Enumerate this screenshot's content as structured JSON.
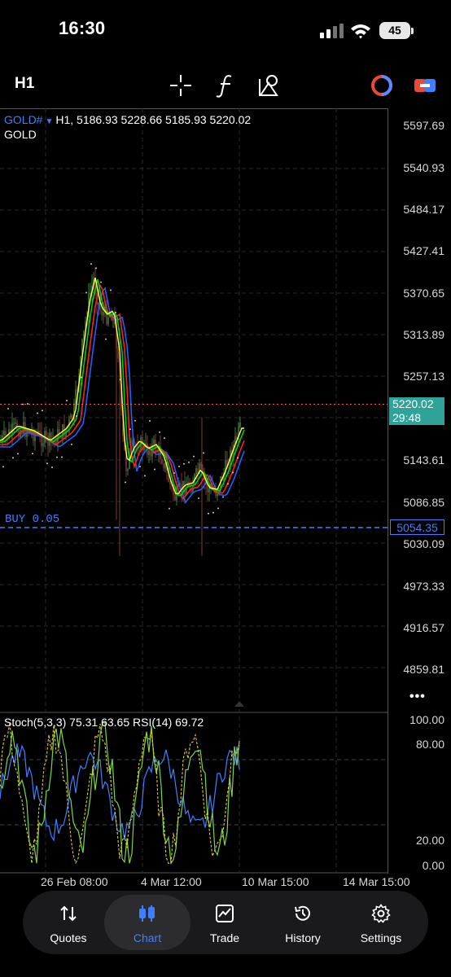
{
  "status_bar": {
    "time": "16:30",
    "battery": "45"
  },
  "toolbar": {
    "timeframe": "H1",
    "tools": [
      "crosshair-icon",
      "function-icon",
      "objects-icon"
    ],
    "right_icons": [
      "indicator-toggle-icon",
      "trade-toggle-icon"
    ]
  },
  "chart": {
    "symbol": "GOLD#",
    "ohlc": "H1, 5186.93 5228.66 5185.93 5220.02",
    "description": "GOLD",
    "price_labels": [
      "5597.69",
      "5540.93",
      "5484.17",
      "5427.41",
      "5370.65",
      "5313.89",
      "5257.13",
      "5143.61",
      "5086.85",
      "5030.09",
      "4973.33",
      "4916.57",
      "4859.81"
    ],
    "current_price": "5220.02",
    "countdown": "29:48",
    "order_label": "BUY 0.05",
    "order_price": "5054.35",
    "colors": {
      "up": "#3a8a40",
      "down": "#8a3535",
      "ma_fast": "#ffff00",
      "ma_mid": "#00d000",
      "ma_slow": "#ff2020",
      "ma_blue": "#2060ff",
      "buy": "#3f7fff",
      "price_tag": "#2fa39a"
    },
    "more_label": "•••"
  },
  "oscillator": {
    "header": "Stoch(5,3,3) 75.31 63.65 RSI(14) 69.72",
    "levels": [
      "100.00",
      "80.00",
      "20.00",
      "0.00"
    ]
  },
  "time_axis": [
    "26 Feb 08:00",
    "4 Mar 12:00",
    "10 Mar 15:00",
    "14 Mar 15:00"
  ],
  "nav": [
    {
      "label": "Quotes",
      "icon": "quotes-icon"
    },
    {
      "label": "Chart",
      "icon": "chart-icon",
      "active": true
    },
    {
      "label": "Trade",
      "icon": "trade-icon"
    },
    {
      "label": "History",
      "icon": "history-icon"
    },
    {
      "label": "Settings",
      "icon": "settings-icon"
    }
  ]
}
